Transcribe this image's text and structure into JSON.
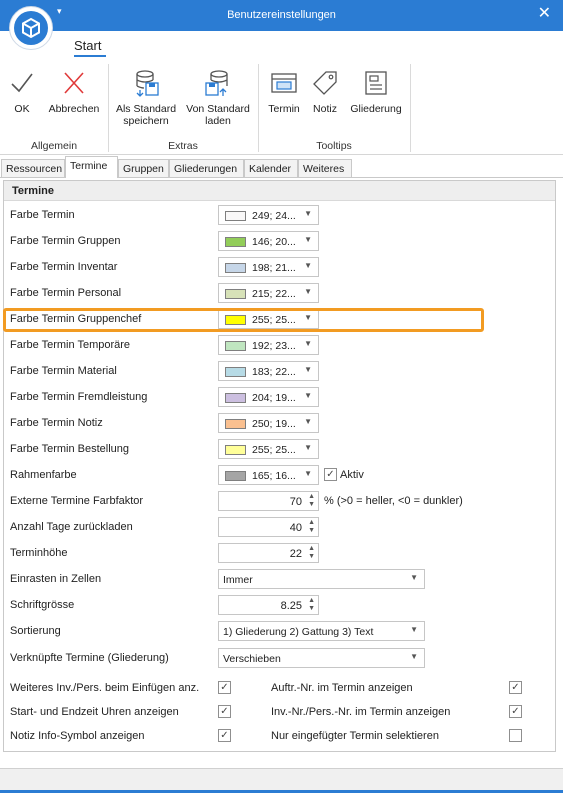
{
  "window": {
    "title": "Benutzereinstellungen",
    "close_glyph": "✕",
    "qat_glyph": "▾"
  },
  "ribbon": {
    "tab": "Start",
    "groups": [
      {
        "label": "Allgemein",
        "buttons": [
          {
            "label": "OK",
            "icon": "checkmark-icon"
          },
          {
            "label": "Abbrechen",
            "icon": "x-icon"
          }
        ]
      },
      {
        "label": "Extras",
        "buttons": [
          {
            "label": "Als Standard speichern",
            "icon": "database-save-icon"
          },
          {
            "label": "Von Standard laden",
            "icon": "database-load-icon"
          }
        ]
      },
      {
        "label": "Tooltips",
        "buttons": [
          {
            "label": "Termin",
            "icon": "appointment-icon"
          },
          {
            "label": "Notiz",
            "icon": "tag-icon"
          },
          {
            "label": "Gliederung",
            "icon": "outline-icon"
          }
        ]
      }
    ]
  },
  "tabs": [
    "Ressourcen",
    "Termine",
    "Gruppen",
    "Gliederungen",
    "Kalender",
    "Weiteres"
  ],
  "active_tab": "Termine",
  "section": {
    "title": "Termine"
  },
  "colors": [
    {
      "label": "Farbe Termin",
      "value": "249; 24...",
      "swatch": "#f9f8f8"
    },
    {
      "label": "Farbe Termin Gruppen",
      "value": "146; 20...",
      "swatch": "#92cd59"
    },
    {
      "label": "Farbe Termin Inventar",
      "value": "198; 21...",
      "swatch": "#c6d6e8"
    },
    {
      "label": "Farbe Termin Personal",
      "value": "215; 22...",
      "swatch": "#d7e2b8"
    },
    {
      "label": "Farbe Termin Gruppenchef",
      "value": "255; 25...",
      "swatch": "#ffff00"
    },
    {
      "label": "Farbe Termin Temporäre",
      "value": "192; 23...",
      "swatch": "#c0e6c0"
    },
    {
      "label": "Farbe Termin Material",
      "value": "183; 22...",
      "swatch": "#b7dbe6"
    },
    {
      "label": "Farbe Termin Fremdleistung",
      "value": "204; 19...",
      "swatch": "#ccbfe0"
    },
    {
      "label": "Farbe Termin Notiz",
      "value": "250; 19...",
      "swatch": "#fac090"
    },
    {
      "label": "Farbe Termin Bestellung",
      "value": "255; 25...",
      "swatch": "#ffff99"
    },
    {
      "label": "Rahmenfarbe",
      "value": "165; 16...",
      "swatch": "#a5a5a5"
    }
  ],
  "rahmen_aktiv": {
    "label": "Aktiv",
    "checked": true
  },
  "farbfaktor": {
    "label": "Externe Termine Farbfaktor",
    "value": "70",
    "hint": "% (>0 = heller, <0 = dunkler)"
  },
  "tage": {
    "label": "Anzahl Tage zurückladen",
    "value": "40"
  },
  "hoehe": {
    "label": "Terminhöhe",
    "value": "22"
  },
  "einrasten": {
    "label": "Einrasten in Zellen",
    "value": "Immer"
  },
  "schrift": {
    "label": "Schriftgrösse",
    "value": "8.25"
  },
  "sortierung": {
    "label": "Sortierung",
    "value": "1) Gliederung 2) Gattung 3) Text"
  },
  "verknuepft": {
    "label": "Verknüpfte Termine (Gliederung)",
    "value": "Verschieben"
  },
  "checks_left": [
    {
      "label": "Weiteres Inv./Pers. beim Einfügen anz.",
      "checked": true
    },
    {
      "label": "Start- und Endzeit Uhren anzeigen",
      "checked": true
    },
    {
      "label": "Notiz Info-Symbol anzeigen",
      "checked": true
    }
  ],
  "checks_right": [
    {
      "label": "Auftr.-Nr. im Termin anzeigen",
      "checked": true
    },
    {
      "label": "Inv.-Nr./Pers.-Nr. im Termin anzeigen",
      "checked": true
    },
    {
      "label": "Nur eingefügter Termin selektieren",
      "checked": false
    }
  ],
  "accent_color": "#2b7cd3",
  "highlight_color": "#f29b22"
}
